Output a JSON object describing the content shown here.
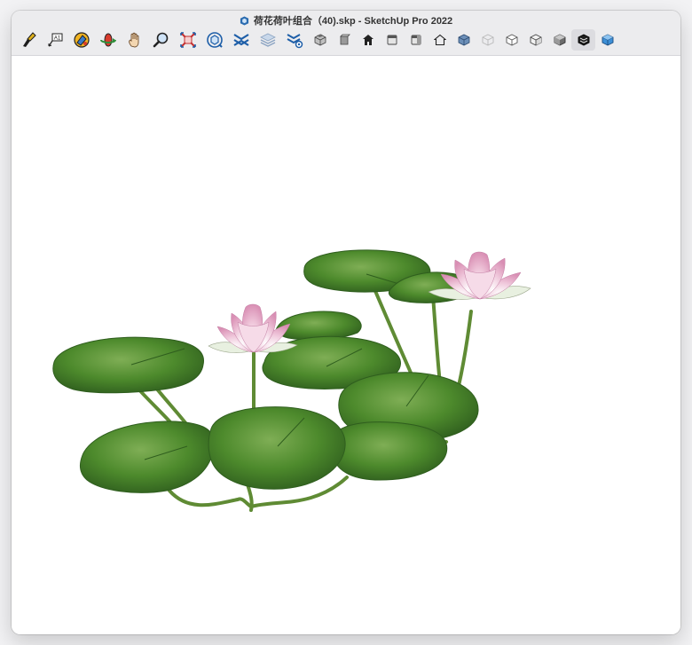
{
  "window": {
    "title": "荷花荷叶组合（40).skp - SketchUp Pro 2022"
  },
  "toolbar": {
    "tools": [
      {
        "name": "paint-select-icon"
      },
      {
        "name": "text-label-icon"
      },
      {
        "name": "paint-bucket-icon"
      },
      {
        "name": "orbit-icon"
      },
      {
        "name": "pan-hand-icon"
      },
      {
        "name": "zoom-icon"
      },
      {
        "name": "zoom-extents-icon"
      },
      {
        "name": "3d-warehouse-icon"
      },
      {
        "name": "extension-warehouse-icon"
      },
      {
        "name": "layers-icon"
      },
      {
        "name": "extension-manager-icon"
      },
      {
        "name": "view-iso-icon"
      },
      {
        "name": "view-top-icon"
      },
      {
        "name": "view-front-icon"
      },
      {
        "name": "view-right-icon"
      },
      {
        "name": "view-back-icon"
      },
      {
        "name": "view-left-icon"
      },
      {
        "name": "style-xray-icon"
      },
      {
        "name": "style-wireframe-icon"
      },
      {
        "name": "style-hidden-line-icon"
      },
      {
        "name": "style-shaded-icon"
      },
      {
        "name": "style-shaded-textures-icon"
      },
      {
        "name": "style-monochrome-icon"
      },
      {
        "name": "style-back-edges-icon"
      }
    ]
  },
  "colors": {
    "leaf_dark": "#2f5e1e",
    "leaf_mid": "#4d8a2c",
    "leaf_light": "#7fae55",
    "stem": "#5f8b34",
    "petal": "#f0c9dc",
    "petal_dark": "#d98fb4",
    "titlebar": "#ececee"
  }
}
